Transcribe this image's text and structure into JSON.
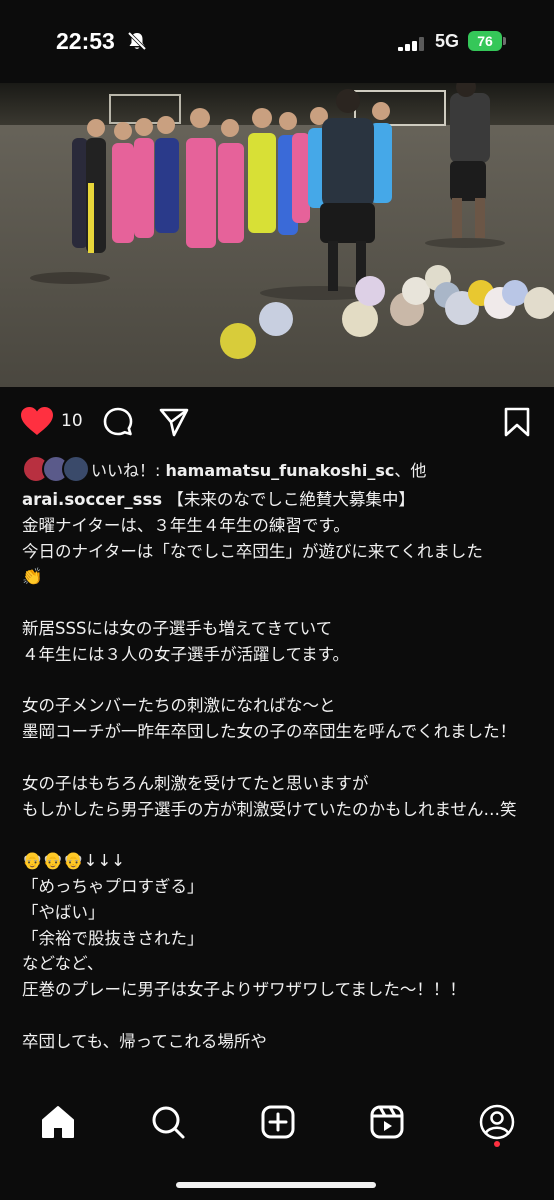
{
  "status": {
    "time": "22:53",
    "network": "5G",
    "battery": "76"
  },
  "post": {
    "like_count": "10",
    "likes_prefix": "いいね！: ",
    "likes_user": "hamamatsu_funakoshi_sc",
    "likes_suffix": "、他",
    "username": "arai.soccer_sss",
    "caption_lines": [
      "【未来のなでしこ絶賛大募集中】",
      "金曜ナイターは、３年生４年生の練習です。",
      "今日のナイターは「なでしこ卒団生」が遊びに来てくれました",
      "👏",
      "",
      "新居SSSには女の子選手も増えてきていて",
      "４年生には３人の女子選手が活躍してます。",
      "",
      "女の子メンバーたちの刺激になればな〜と",
      "墨岡コーチが一昨年卒団した女の子の卒団生を呼んでくれました！",
      "",
      "女の子はもちろん刺激を受けてたと思いますが",
      "もしかしたら男子選手の方が刺激受けていたのかもしれません…笑",
      "",
      "👴👴👴↓↓↓",
      "「めっちゃプロすぎる」",
      "「やばい」",
      "「余裕で股抜きされた」",
      "などなど、",
      "圧巻のプレーに男子は女子よりザワザワしてました〜！！！",
      "",
      "卒団しても、帰ってこれる場所や"
    ]
  },
  "icons": {
    "like": "heart-icon",
    "comment": "comment-icon",
    "share": "share-icon",
    "save": "bookmark-icon",
    "nav": [
      "home-icon",
      "search-icon",
      "create-icon",
      "reels-icon",
      "profile-icon"
    ]
  },
  "colors": {
    "like": "#ff3040",
    "battery": "#35c759",
    "background": "#0c0c0c"
  }
}
